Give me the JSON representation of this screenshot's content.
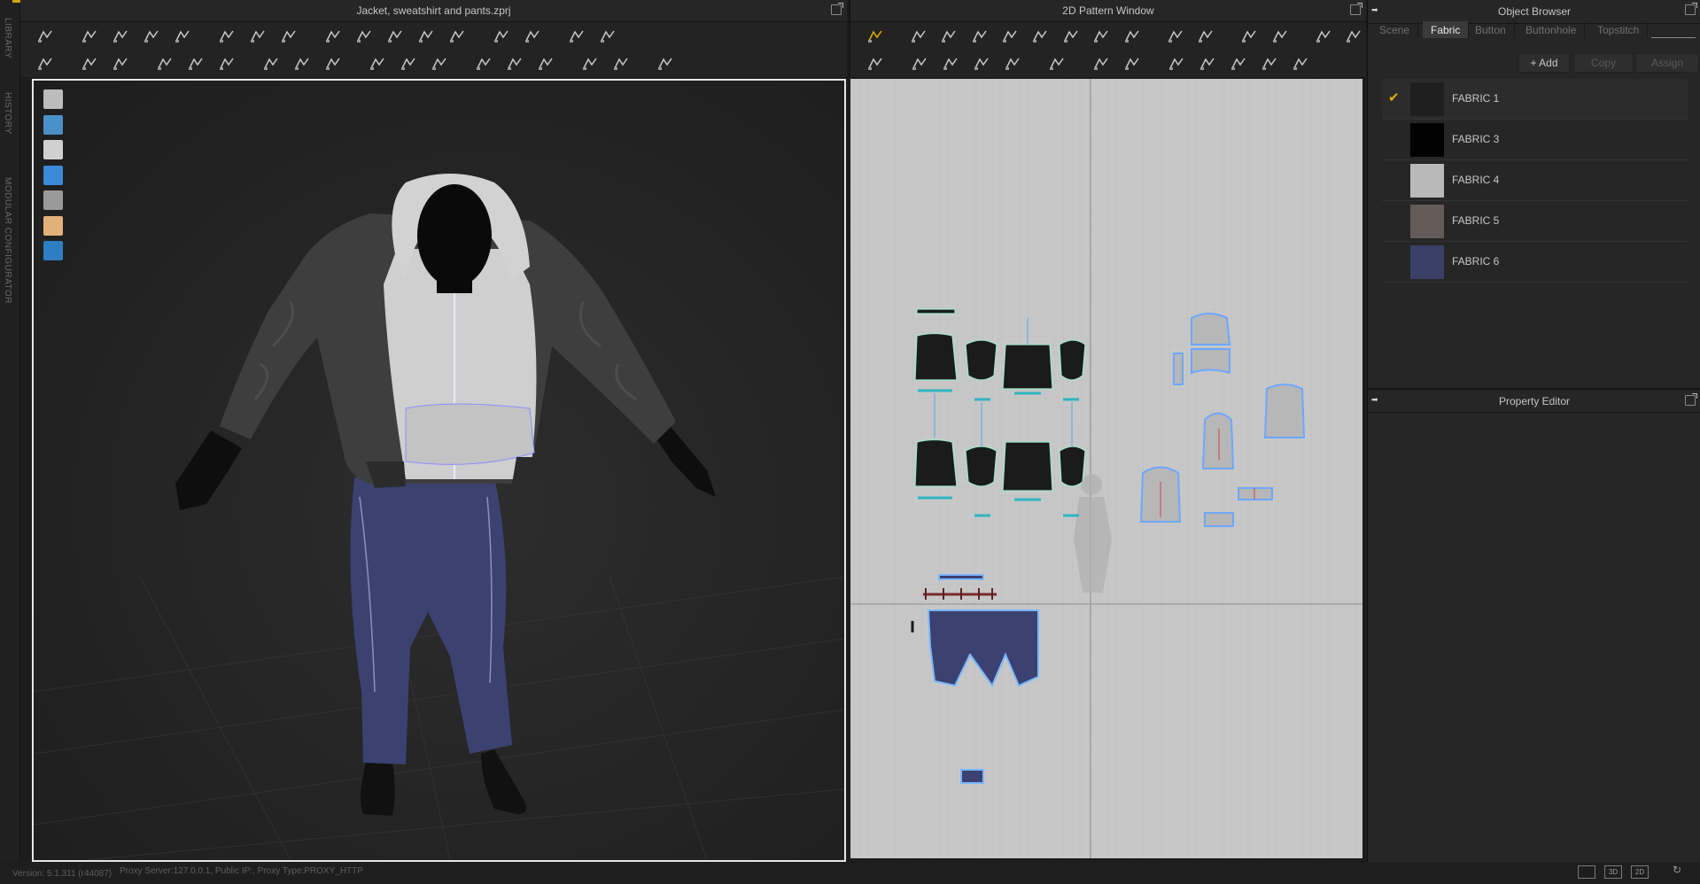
{
  "app": {
    "left_vertical_tabs": [
      "LIBRARY",
      "HISTORY",
      "MODULAR CONFIGURATOR"
    ]
  },
  "scene_window": {
    "title": "Jacket, sweatshirt and pants.zprj",
    "toolbar_row1_icons": [
      "simulation-arrow-icon",
      "select-move-icon",
      "transform-pattern-icon",
      "edit-curvature-icon",
      "segment-select-icon",
      "symmetric-edit-icon",
      "rotate-icon",
      "rotate-pattern-icon",
      "draw-line-icon",
      "tape-icon",
      "bond-icon",
      "internal-line-icon",
      "arrange-icon",
      "fold-icon",
      "avatar-icon",
      "grid-icon",
      "grid-large-icon"
    ],
    "toolbar_row2_icons": [
      "avatar-pose-icon",
      "pin-icon",
      "needle-icon",
      "segment-sew-icon",
      "free-sew-icon",
      "tack-icon",
      "hanger-icon",
      "fold-arrange-icon",
      "shirring-icon",
      "button-icon",
      "buttonhole-icon",
      "topstitch-icon",
      "zipper-icon",
      "lock-icon",
      "measure-icon",
      "ruler-icon",
      "flatten-icon",
      "move-axis-icon"
    ],
    "side_icons": [
      "garment-icon",
      "fabric-property-icon",
      "avatar-icon",
      "texture-icon",
      "render-icon",
      "skin-icon",
      "globe-icon"
    ]
  },
  "pattern_window": {
    "title": "2D Pattern Window",
    "toolbar_row1_icons": [
      "transform-pattern-icon",
      "edit-points-icon",
      "curve-point-icon",
      "edit-curvature-icon",
      "edit-segment-icon",
      "polygon-icon",
      "rectangle-icon",
      "circle-icon",
      "internal-polygon-icon",
      "internal-rectangle-icon",
      "trace-icon",
      "fold-icon",
      "unfold-icon",
      "grid-icon",
      "grid-large-icon"
    ],
    "toolbar_row2_icons": [
      "sew-icon",
      "free-sew-icon",
      "free-sew-2-icon",
      "check-sew-icon",
      "measure-icon",
      "steam-icon",
      "hanger-icon",
      "needle-icon",
      "shirring-icon",
      "button-icon",
      "buttonhole-icon",
      "topstitch-icon",
      "zipper-icon"
    ]
  },
  "object_browser": {
    "title": "Object Browser",
    "tabs": [
      {
        "label": "Scene",
        "active": false
      },
      {
        "label": "Fabric",
        "active": true
      },
      {
        "label": "Button",
        "active": false
      },
      {
        "label": "Buttonhole",
        "active": false
      },
      {
        "label": "Topstitch",
        "active": false
      }
    ],
    "add_label": "+ Add",
    "copy_label": "Copy",
    "assign_label": "Assign",
    "fabrics": [
      {
        "name": "FABRIC 1",
        "color": "#1f1f1f",
        "selected": true
      },
      {
        "name": "FABRIC 3",
        "color": "#020202",
        "selected": false
      },
      {
        "name": "FABRIC 4",
        "color": "#b9b9b9",
        "selected": false
      },
      {
        "name": "FABRIC 5",
        "color": "#645b58",
        "selected": false
      },
      {
        "name": "FABRIC 6",
        "color": "#3a4068",
        "selected": false
      }
    ]
  },
  "property_editor": {
    "title": "Property Editor"
  },
  "status_bar": {
    "version": "Version: 5.1.311 (r44087)",
    "proxy": "Proxy Server:127.0.0.1, Public IP:, Proxy Type:PROXY_HTTP",
    "view_buttons": [
      "",
      "3D",
      "2D",
      ""
    ]
  },
  "colors": {
    "accent_yellow": "#e3b000",
    "viewport_border": "#e6e6e6",
    "pattern_bg": "#c7c7c7",
    "jeans": "#3b4170",
    "hoodie": "#cfcfcf",
    "jacket": "#3e3e3e"
  }
}
